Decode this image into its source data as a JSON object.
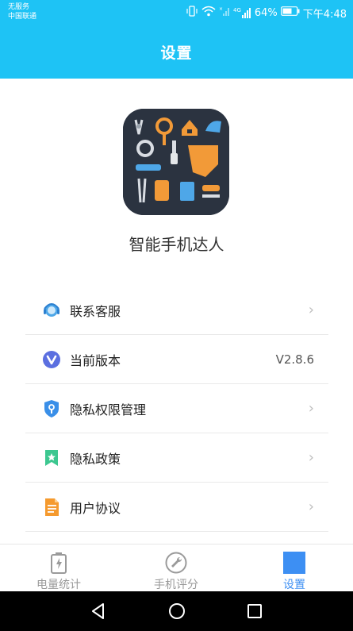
{
  "status_bar": {
    "carrier_line1": "无服务",
    "carrier_line2": "中国联通",
    "network": "4G",
    "battery": "64%",
    "time": "下午4:48"
  },
  "header": {
    "title": "设置"
  },
  "app": {
    "name": "智能手机达人",
    "icon": "tools-app-icon"
  },
  "menu": {
    "items": [
      {
        "label": "联系客服",
        "icon": "customer-service-icon"
      },
      {
        "label": "当前版本",
        "icon": "version-icon",
        "value": "V2.8.6"
      },
      {
        "label": "隐私权限管理",
        "icon": "shield-icon"
      },
      {
        "label": "隐私政策",
        "icon": "bookmark-icon"
      },
      {
        "label": "用户协议",
        "icon": "document-icon"
      }
    ]
  },
  "tabs": [
    {
      "label": "电量统计",
      "icon": "battery-icon",
      "active": false
    },
    {
      "label": "手机评分",
      "icon": "wrench-icon",
      "active": false
    },
    {
      "label": "设置",
      "icon": "settings-square-icon",
      "active": true
    }
  ],
  "colors": {
    "header": "#1ec3f5",
    "accent": "#3d8ff3",
    "tab_inactive": "#999999"
  }
}
